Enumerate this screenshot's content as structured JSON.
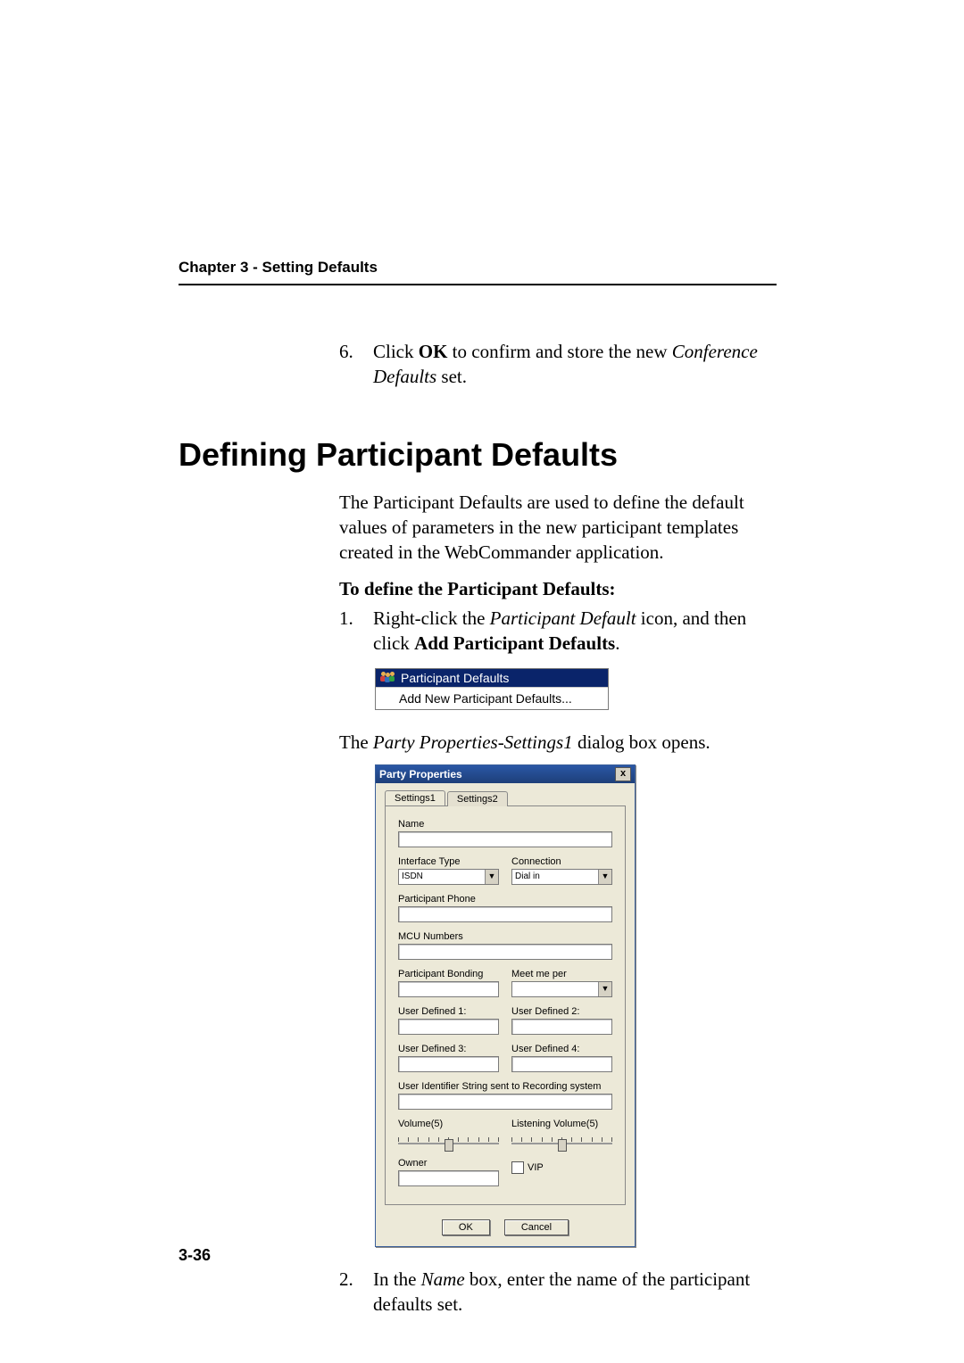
{
  "header": {
    "running_head": "Chapter 3 - Setting Defaults"
  },
  "step6": {
    "num": "6.",
    "t1": "Click ",
    "ok": "OK",
    "t2": " to confirm and store the new ",
    "em": "Conference Defaults",
    "t3": " set."
  },
  "h1": "Defining Participant Defaults",
  "intro_p1": "The Participant Defaults are used to define the default values of parameters in the new participant templates created in the WebCommander application.",
  "subhead": "To define the Participant Defaults:",
  "step1": {
    "num": "1.",
    "t1": "Right-click the ",
    "em1": "Participant Default",
    "t2": " icon, and then click ",
    "b1": "Add Participant Defaults",
    "t3": "."
  },
  "ctx": {
    "highlight": "Participant Defaults",
    "item": "Add New Participant Defaults..."
  },
  "post_ctx": {
    "t1": "The ",
    "em": "Party Properties-Settings1",
    "t2": " dialog box opens."
  },
  "dialog": {
    "title": "Party Properties",
    "close": "x",
    "tabs": {
      "t1": "Settings1",
      "t2": "Settings2"
    },
    "labels": {
      "name": "Name",
      "iface": "Interface Type",
      "conn": "Connection",
      "pphone": "Participant Phone",
      "mcu": "MCU Numbers",
      "bonding": "Participant Bonding",
      "meetme": "Meet me per",
      "ud1": "User Defined 1:",
      "ud2": "User Defined 2:",
      "ud3": "User Defined 3:",
      "ud4": "User Defined 4:",
      "uid": "User Identifier String sent to Recording system",
      "vol": "Volume(5)",
      "lvol": "Listening Volume(5)",
      "owner": "Owner",
      "vip": "VIP"
    },
    "values": {
      "iface": "ISDN",
      "conn": "Dial in"
    },
    "buttons": {
      "ok": "OK",
      "cancel": "Cancel"
    }
  },
  "step2": {
    "num": "2.",
    "t1": "In the ",
    "em": "Name",
    "t2": " box, enter the name of the participant defaults set."
  },
  "page_num": "3-36"
}
